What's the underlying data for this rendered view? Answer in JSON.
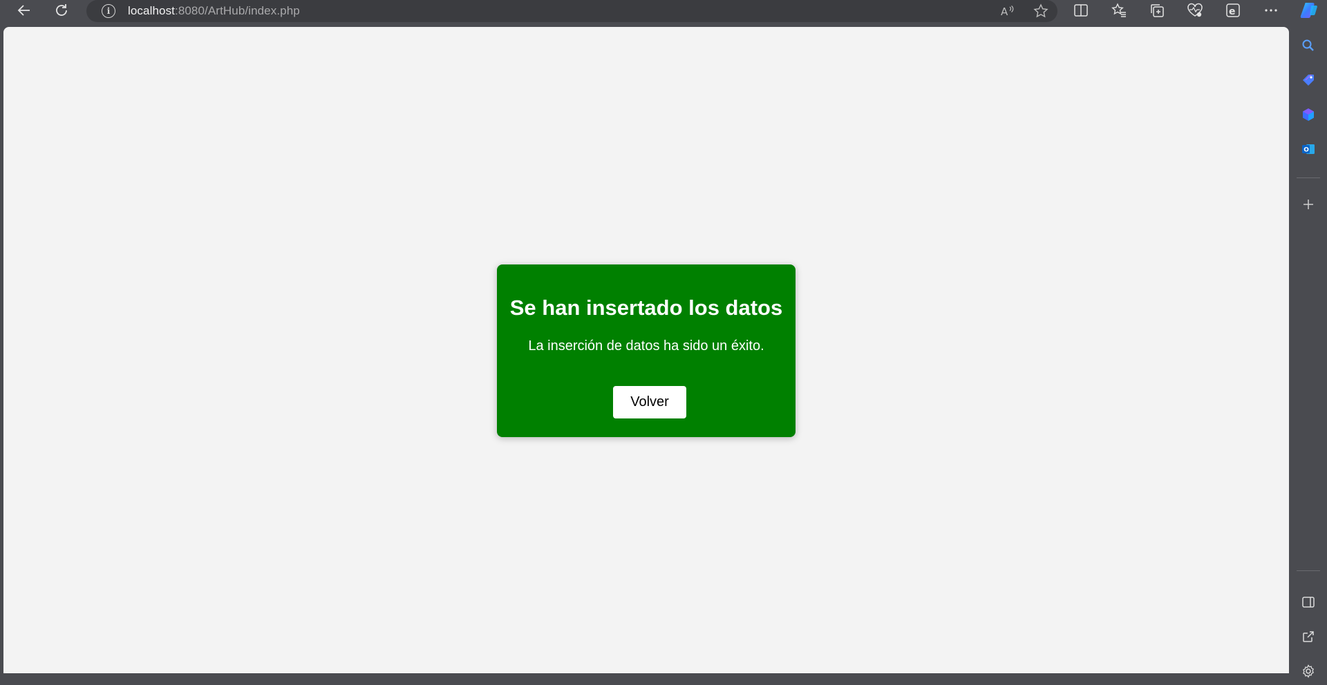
{
  "browser": {
    "url_host": "localhost",
    "url_rest": ":8080/ArtHub/index.php",
    "icons": {
      "back": "back-arrow-icon",
      "refresh": "refresh-icon",
      "info": "info-icon",
      "read_aloud": "read-aloud-icon",
      "favorite": "star-icon",
      "split_screen": "split-screen-icon",
      "favorites": "favorites-icon",
      "collections": "collections-icon",
      "health": "browser-essentials-icon",
      "ie_mode": "ie-mode-icon",
      "more": "more-icon",
      "copilot": "copilot-icon"
    }
  },
  "sidebar": {
    "icons": [
      "search-icon",
      "shopping-tag-icon",
      "office-icon",
      "outlook-icon",
      "add-icon",
      "sidebar-toggle-icon",
      "external-link-icon",
      "settings-icon"
    ]
  },
  "page": {
    "title": "Se han insertado los datos",
    "message": "La inserción de datos ha sido un éxito.",
    "button_label": "Volver",
    "card_color": "#008000"
  }
}
